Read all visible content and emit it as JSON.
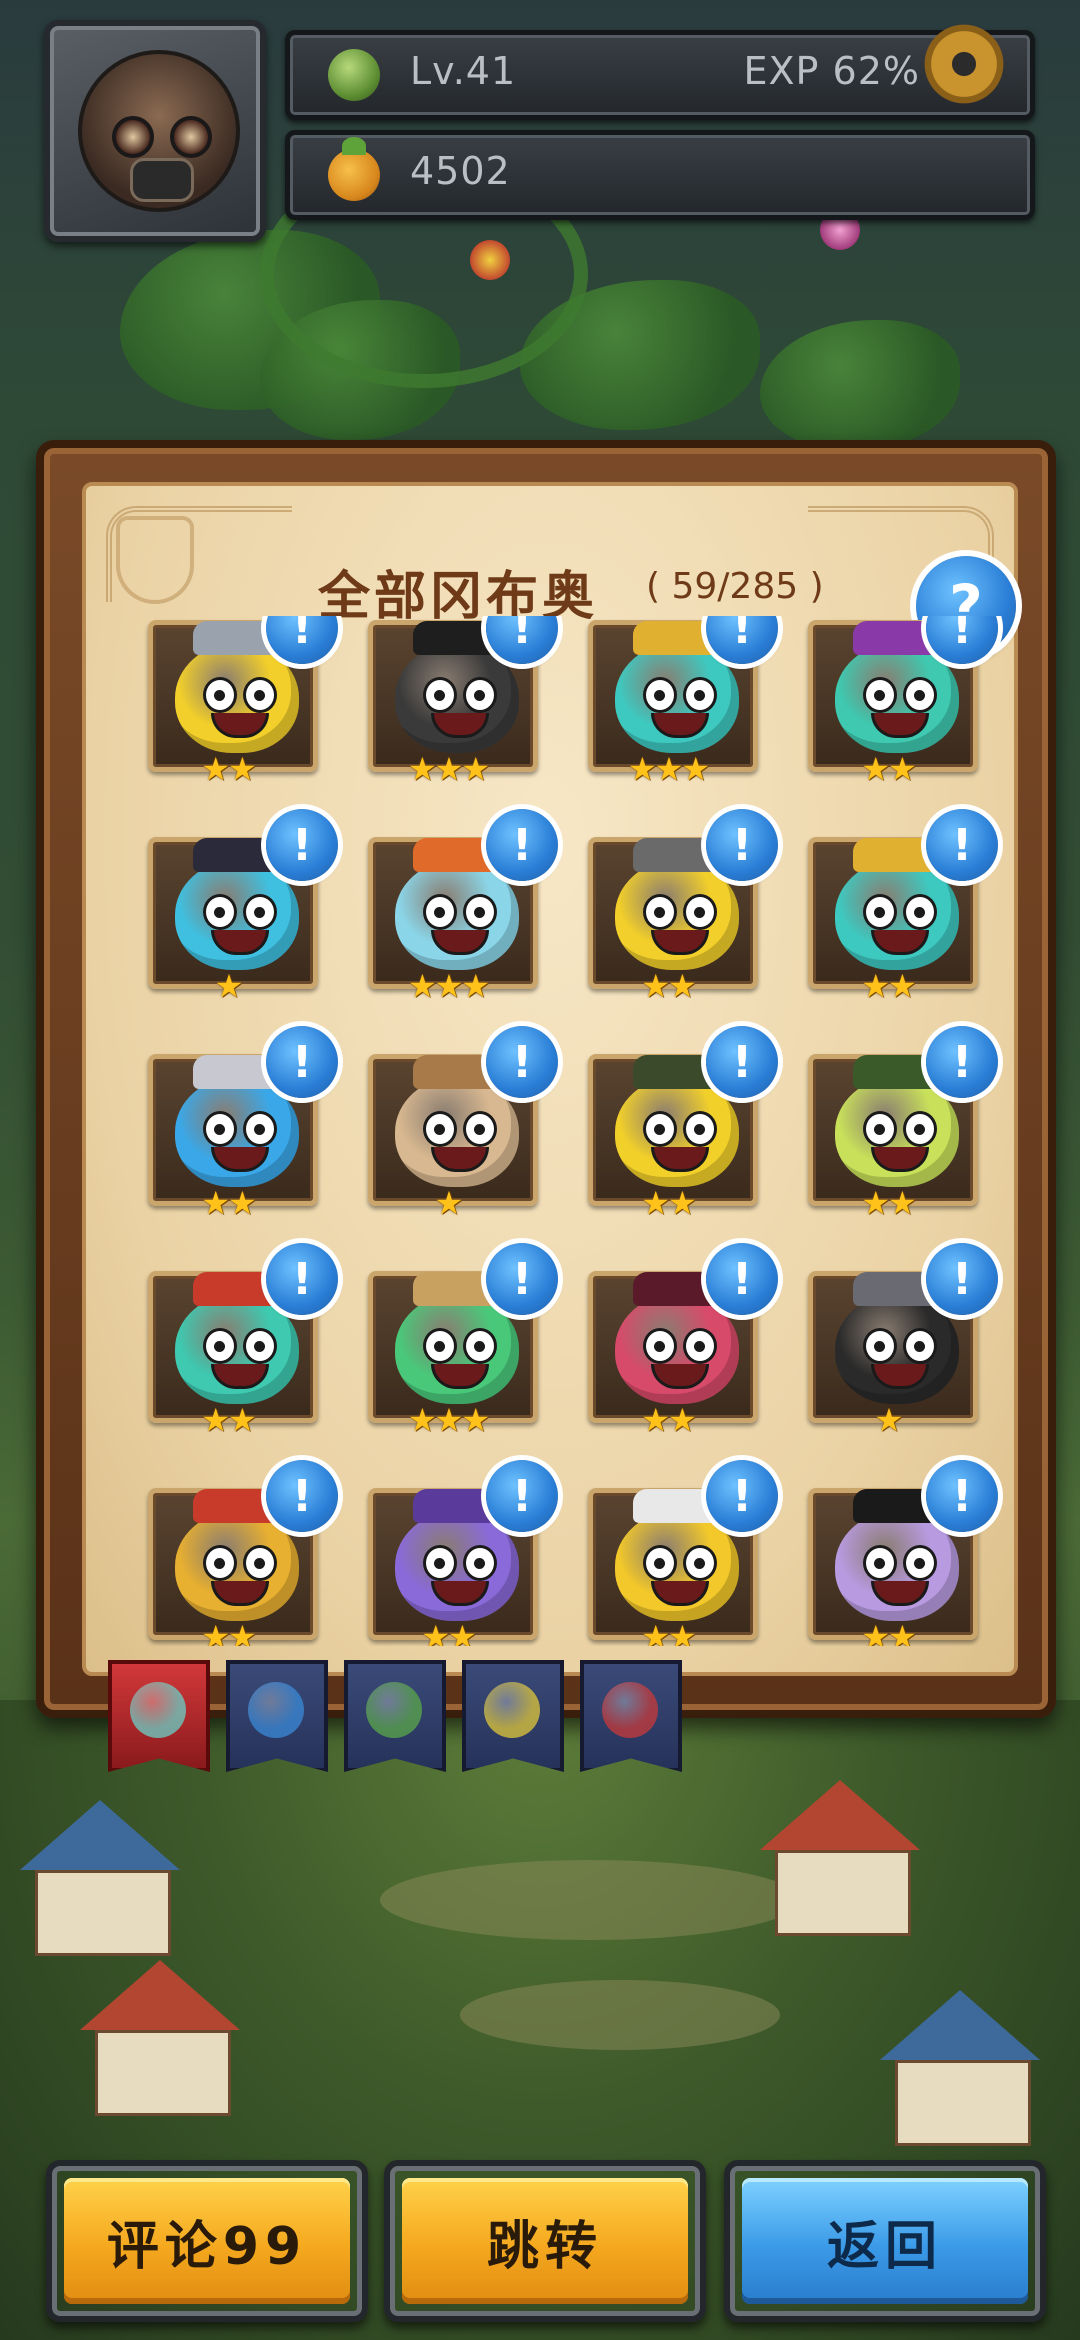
{
  "hud": {
    "level": "Lv.41",
    "exp": "EXP  62%",
    "coins": "4502"
  },
  "panel": {
    "title": "全部冈布奥",
    "count": "( 59/285 )",
    "help_symbol": "?"
  },
  "alert_symbol": "!",
  "gumballs": [
    {
      "row": 0,
      "col": 0,
      "stars": "★★",
      "color": "#f2cf2a",
      "hat": "#9aa3ad",
      "alert": false
    },
    {
      "row": 0,
      "col": 1,
      "stars": "★★★",
      "color": "#3a3a3a",
      "hat": "#1e1e1e",
      "alert": false
    },
    {
      "row": 0,
      "col": 2,
      "stars": "★★★",
      "color": "#3ec9c0",
      "hat": "#e0b030",
      "alert": false
    },
    {
      "row": 0,
      "col": 3,
      "stars": "★★",
      "color": "#3ec9b0",
      "hat": "#8a3aa8",
      "alert": false
    },
    {
      "row": 1,
      "col": 0,
      "stars": "★",
      "color": "#3fc0e0",
      "hat": "#2a2a3a",
      "alert": true
    },
    {
      "row": 1,
      "col": 1,
      "stars": "★★★",
      "color": "#8ad6e8",
      "hat": "#e06a2a",
      "alert": true
    },
    {
      "row": 1,
      "col": 2,
      "stars": "★★",
      "color": "#f2cf2a",
      "hat": "#6a6a6a",
      "alert": true
    },
    {
      "row": 1,
      "col": 3,
      "stars": "★★",
      "color": "#3ec9c0",
      "hat": "#e0b030",
      "alert": true
    },
    {
      "row": 2,
      "col": 0,
      "stars": "★★",
      "color": "#3aa8e8",
      "hat": "#c8c8d0",
      "alert": true
    },
    {
      "row": 2,
      "col": 1,
      "stars": "★",
      "color": "#d8b890",
      "hat": "#a87a4a",
      "alert": true
    },
    {
      "row": 2,
      "col": 2,
      "stars": "★★",
      "color": "#f2d02a",
      "hat": "#3a4a2a",
      "alert": true
    },
    {
      "row": 2,
      "col": 3,
      "stars": "★★",
      "color": "#c8e05a",
      "hat": "#3a5a2a",
      "alert": true
    },
    {
      "row": 3,
      "col": 0,
      "stars": "★★",
      "color": "#3ec9b0",
      "hat": "#c83a2a",
      "alert": true
    },
    {
      "row": 3,
      "col": 1,
      "stars": "★★★",
      "color": "#4ac87a",
      "hat": "#c8a060",
      "alert": true
    },
    {
      "row": 3,
      "col": 2,
      "stars": "★★",
      "color": "#d84a6a",
      "hat": "#5a1a2a",
      "alert": true
    },
    {
      "row": 3,
      "col": 3,
      "stars": "★",
      "color": "#2a2a2a",
      "hat": "#6a6a72",
      "alert": true
    },
    {
      "row": 4,
      "col": 0,
      "stars": "★★",
      "color": "#e8b030",
      "hat": "#c83a2a",
      "alert": true
    },
    {
      "row": 4,
      "col": 1,
      "stars": "★★",
      "color": "#8a6ad8",
      "hat": "#5a3a9a",
      "alert": true
    },
    {
      "row": 4,
      "col": 2,
      "stars": "★★",
      "color": "#f2c82a",
      "hat": "#e8e8e8",
      "alert": true
    },
    {
      "row": 4,
      "col": 3,
      "stars": "★★",
      "color": "#b89ae0",
      "hat": "#1a1a1a",
      "alert": true
    }
  ],
  "tabs": [
    {
      "name": "all",
      "active": true,
      "icon_color": "#6ad0c8"
    },
    {
      "name": "water",
      "active": false,
      "icon_color": "#3a8ad8"
    },
    {
      "name": "nature",
      "active": false,
      "icon_color": "#5aa84a"
    },
    {
      "name": "light",
      "active": false,
      "icon_color": "#e0c83a"
    },
    {
      "name": "dark",
      "active": false,
      "icon_color": "#c83a3a"
    }
  ],
  "buttons": {
    "comments": "评论99",
    "jump": "跳转",
    "back": "返回"
  },
  "colors": {
    "gold_button": "#f5a81e",
    "blue_button": "#3a9ae8",
    "title": "#6e3a18",
    "star": "#ffc21a",
    "badge": "#2a7ed6"
  }
}
